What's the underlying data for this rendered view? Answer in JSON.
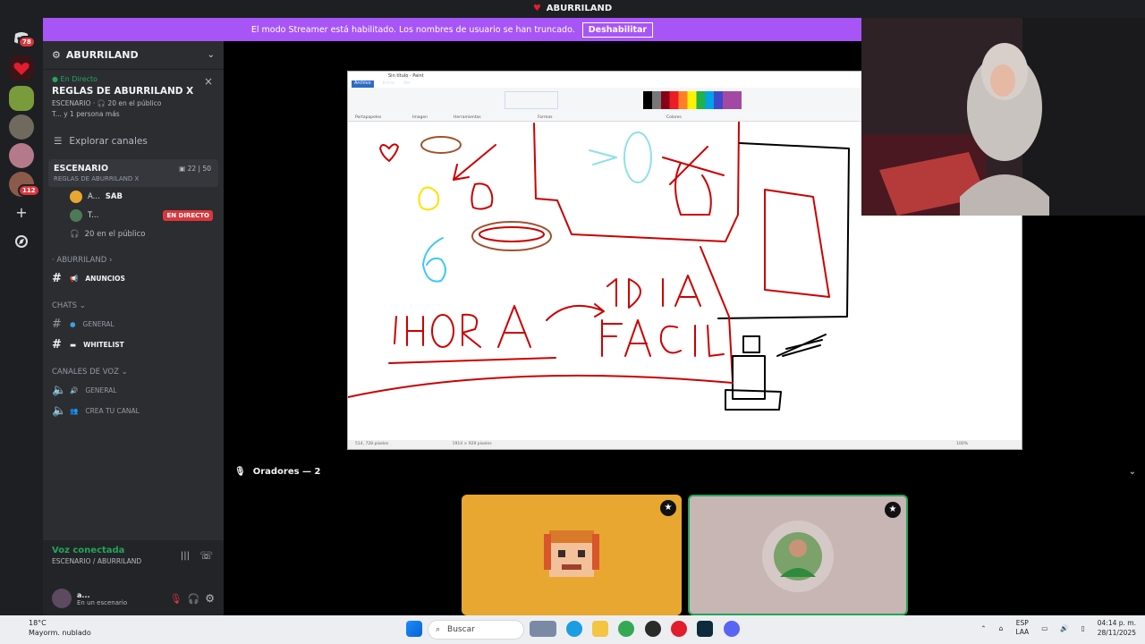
{
  "window": {
    "title": "ABURRILAND"
  },
  "banner": {
    "text": "El modo Streamer está habilitado. Los nombres de usuario se han truncado.",
    "button": "Deshabilitar"
  },
  "rail": {
    "badges": [
      "78",
      "112"
    ]
  },
  "server": {
    "name": "ABURRILAND"
  },
  "stage_card": {
    "live": "En Directo",
    "title": "REGLAS DE ABURRILAND X",
    "meta1": "ESCENARIO · 🎧 20 en el público",
    "meta2": "T... y 1 persona más"
  },
  "explore": "Explorar canales",
  "active_channel": {
    "name": "ESCENARIO",
    "topic": "REGLAS DE ABURRILAND X",
    "count_a": "22",
    "count_b": "50",
    "users": [
      {
        "name": "A...",
        "tag": "SAB"
      },
      {
        "name": "T...",
        "badge": "EN DIRECTO"
      }
    ],
    "audience": "20 en el público"
  },
  "categories": [
    {
      "label": "ABURRILAND",
      "channels": [
        {
          "name": "ANUNCIOS",
          "bold": true
        }
      ]
    },
    {
      "label": "CHATS",
      "channels": [
        {
          "name": "GENERAL",
          "bold": false
        },
        {
          "name": "WHITELIST",
          "bold": true
        }
      ]
    },
    {
      "label": "CANALES DE VOZ",
      "channels": [
        {
          "name": "GENERAL",
          "bold": false
        },
        {
          "name": "CREA TU CANAL",
          "bold": false
        }
      ]
    }
  ],
  "voice": {
    "status": "Voz conectada",
    "where": "ESCENARIO / ABURRILAND"
  },
  "user": {
    "name": "a...",
    "status": "En un escenario"
  },
  "paint": {
    "title": "Sin título - Paint",
    "tabs": [
      "Archivo",
      "Inicio",
      "Ver"
    ],
    "groups": [
      "Portapapeles",
      "Imagen",
      "Herramientas",
      "Formas",
      "Colores"
    ],
    "status_left": "514, 728 píxeles",
    "status_mid": "1914 × 929 píxeles",
    "zoom": "100%",
    "drawing_text": [
      "1HORA",
      "1 DIA",
      "FACIL",
      "6"
    ]
  },
  "speakers": {
    "label": "Oradores — 2"
  },
  "taskbar": {
    "temp": "18°C",
    "weather": "Mayorm. nublado",
    "search": "Buscar",
    "lang1": "ESP",
    "lang2": "LAA",
    "time": "04:14 p. m.",
    "date": "28/11/2025"
  },
  "colors": {
    "banner": "#a855f7",
    "live_green": "#23a55a",
    "live_red": "#da373c",
    "tile_left": "#e8a730",
    "tile_right": "#c7b6b4"
  }
}
